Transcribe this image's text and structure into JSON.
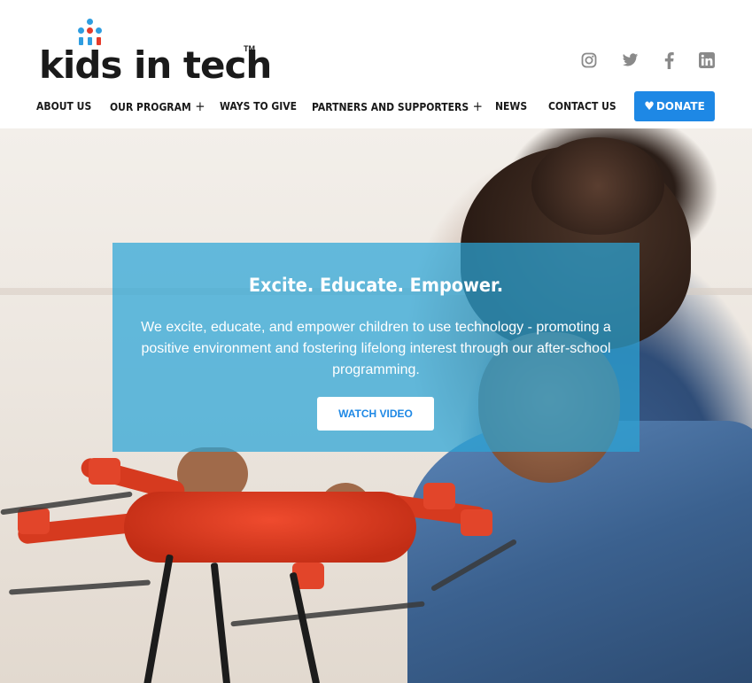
{
  "brand": {
    "logo_text": "kids in tech",
    "trademark": "TM",
    "logo_colors": {
      "blue": "#2e9de0",
      "red": "#e53a2a",
      "dark": "#1a1a1a"
    }
  },
  "social": [
    {
      "name": "instagram",
      "icon": "instagram-icon"
    },
    {
      "name": "twitter",
      "icon": "twitter-icon"
    },
    {
      "name": "facebook",
      "icon": "facebook-icon"
    },
    {
      "name": "linkedin",
      "icon": "linkedin-icon"
    }
  ],
  "nav": {
    "items": [
      {
        "label": "ABOUT US",
        "has_submenu": false
      },
      {
        "label": "OUR PROGRAM",
        "has_submenu": true
      },
      {
        "label": "WAYS TO GIVE",
        "has_submenu": false
      },
      {
        "label": "PARTNERS AND SUPPORTERS",
        "has_submenu": true
      },
      {
        "label": "NEWS",
        "has_submenu": false
      },
      {
        "label": "CONTACT US",
        "has_submenu": false
      }
    ],
    "submenu_symbol": "+",
    "donate_label": "DONATE",
    "donate_icon": "heart-icon"
  },
  "hero": {
    "title": "Excite. Educate. Empower.",
    "description": "We excite, educate, and empower children to use technology - promoting a positive environment and fostering lifelong interest through our after-school programming.",
    "button_label": "WATCH VIDEO"
  },
  "colors": {
    "accent": "#1e88e5",
    "overlay": "#2ba5d7",
    "text_dark": "#1a1a1a",
    "icon_gray": "#8a8a8a"
  }
}
